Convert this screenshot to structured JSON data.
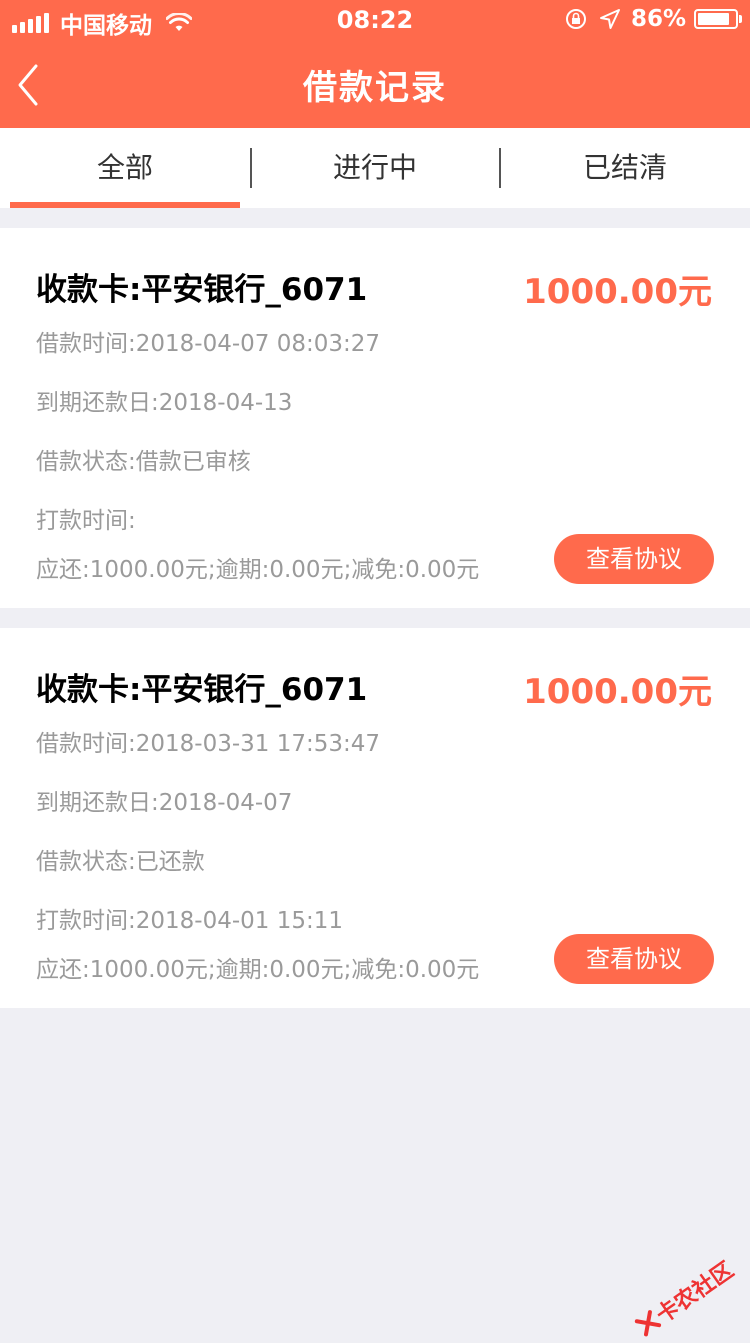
{
  "status_bar": {
    "carrier": "中国移动",
    "time": "08:22",
    "battery_percent": "86%",
    "battery_level": 0.86
  },
  "nav": {
    "title": "借款记录",
    "back_icon": "chevron-left-icon"
  },
  "tabs": [
    {
      "label": "全部",
      "active": true
    },
    {
      "label": "进行中",
      "active": false
    },
    {
      "label": "已结清",
      "active": false
    }
  ],
  "records": [
    {
      "card": "收款卡:平安银行_6071",
      "amount": "1000.00元",
      "loan_time": "借款时间:2018-04-07 08:03:27",
      "due_date": "到期还款日:2018-04-13",
      "status": "借款状态:借款已审核",
      "transfer_time": "打款时间:",
      "summary": "应还:1000.00元;逾期:0.00元;减免:0.00元",
      "button": "查看协议"
    },
    {
      "card": "收款卡:平安银行_6071",
      "amount": "1000.00元",
      "loan_time": "借款时间:2018-03-31 17:53:47",
      "due_date": "到期还款日:2018-04-07",
      "status": "借款状态:已还款",
      "transfer_time": "打款时间:2018-04-01 15:11",
      "summary": "应还:1000.00元;逾期:0.00元;减免:0.00元",
      "button": "查看协议"
    }
  ],
  "watermark": "卡农社区",
  "colors": {
    "brand": "#ff6a4c",
    "background": "#efeff4",
    "secondary_text": "#9a9a9a"
  }
}
